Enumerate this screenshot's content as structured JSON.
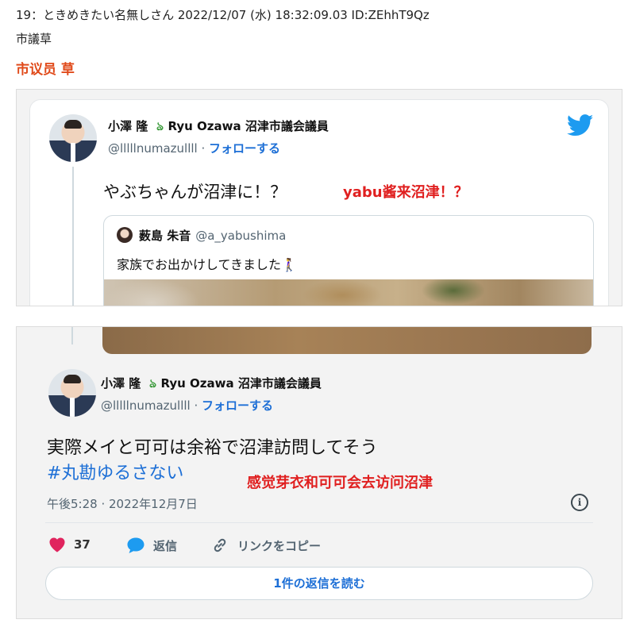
{
  "post": {
    "header": "19：ときめきたい名無しさん 2022/12/07 (水) 18:32:09.03 ID:ZEhhT9Qz",
    "body": "市議草",
    "translation": "市议员 草"
  },
  "colors": {
    "accent_red": "#e01f1f",
    "translation_orange": "#e04a1a",
    "twitter_blue": "#1d9bf0",
    "link_blue": "#1d6fd6",
    "like_pink": "#e0245e"
  },
  "tweet_top": {
    "author": {
      "name_part1": "小澤 隆",
      "name_part2": "Ryu Ozawa 沼津市議会議員",
      "handle": "@lllllnumazullll",
      "follow_label": "フォローする"
    },
    "text": "やぶちゃんが沼津に！？",
    "annotation": "yabu酱来沼津！？",
    "quote": {
      "name": "薮島 朱音",
      "handle": "@a_yabushima",
      "text": "家族でお出かけしてきました🚶‍♀️"
    }
  },
  "tweet_bottom": {
    "author": {
      "name_part1": "小澤 隆",
      "name_part2": "Ryu Ozawa 沼津市議会議員",
      "handle": "@lllllnumazullll",
      "follow_label": "フォローする"
    },
    "text": "実際メイと可可は余裕で沼津訪問してそう",
    "hashtag": "#丸勘ゆるさない",
    "annotation": "感觉芽衣和可可会去访问沼津",
    "timestamp": "午後5:28 · 2022年12月7日",
    "actions": {
      "like_count": "37",
      "reply_label": "返信",
      "copy_link_label": "リンクをコピー"
    },
    "read_replies_label": "1件の返信を読む"
  }
}
